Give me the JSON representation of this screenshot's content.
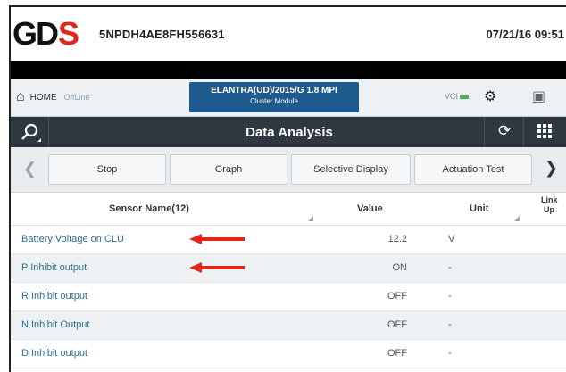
{
  "header": {
    "logo_main": "GD",
    "logo_accent": "S",
    "vin": "5NPDH4AE8FH556631",
    "datetime": "07/21/16 09:51"
  },
  "nav": {
    "home_icon": "home-icon",
    "home_label": "HOME",
    "status": "OffLine",
    "vehicle": "ELANTRA(UD)/2015/G 1.8 MPI",
    "module": "Cluster Module",
    "vci_label": "VCI"
  },
  "titlebar": {
    "title": "Data Analysis"
  },
  "toolbar": {
    "buttons": [
      "Stop",
      "Graph",
      "Selective Display",
      "Actuation Test"
    ]
  },
  "table": {
    "headers": {
      "sensor_name": "Sensor Name(12)",
      "value": "Value",
      "unit": "Unit",
      "link_up_1": "Link",
      "link_up_2": "Up"
    },
    "rows": [
      {
        "name": "Battery Voltage on CLU",
        "value": "12.2",
        "unit": "V"
      },
      {
        "name": "P Inhibit output",
        "value": "ON",
        "unit": "-"
      },
      {
        "name": "R Inhibit output",
        "value": "OFF",
        "unit": "-"
      },
      {
        "name": "N Inhibit Output",
        "value": "OFF",
        "unit": "-"
      },
      {
        "name": "D Inhibit output",
        "value": "OFF",
        "unit": "-"
      }
    ]
  },
  "colors": {
    "accent_red": "#e1261c",
    "vehicle_blue": "#1f5a8f",
    "titlebar_dark": "#2f3740",
    "sensor_text": "#2c6e8f"
  }
}
